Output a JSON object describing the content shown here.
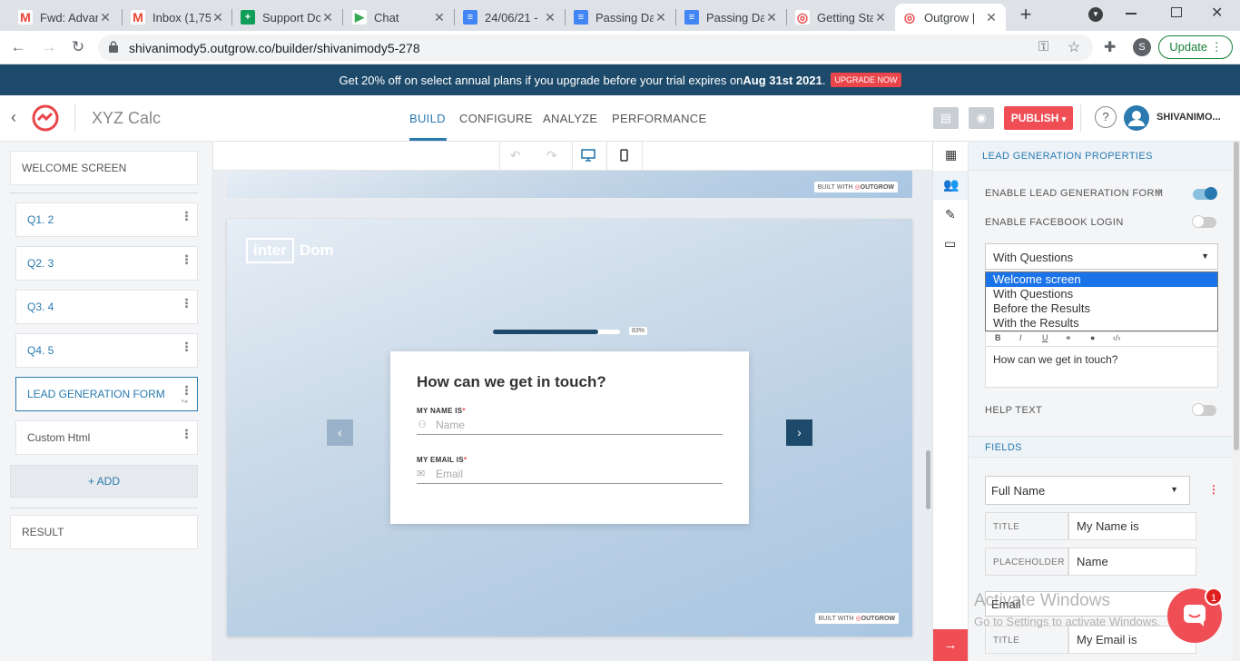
{
  "browser": {
    "tabs": [
      {
        "title": "Fwd: Advar",
        "icon": "gmail-icon",
        "color": "#ea4335",
        "glyph": "M"
      },
      {
        "title": "Inbox (1,75",
        "icon": "gmail-icon",
        "color": "#ea4335",
        "glyph": "M"
      },
      {
        "title": "Support Do",
        "icon": "sheets-icon",
        "color": "#0f9d58",
        "glyph": "+"
      },
      {
        "title": "Chat",
        "icon": "chat-icon",
        "color": "#34a853",
        "glyph": "▶"
      },
      {
        "title": "24/06/21 -",
        "icon": "docs-icon",
        "color": "#4285f4",
        "glyph": "≡"
      },
      {
        "title": "Passing Da",
        "icon": "docs-icon",
        "color": "#4285f4",
        "glyph": "≡"
      },
      {
        "title": "Passing Da",
        "icon": "docs-icon",
        "color": "#4285f4",
        "glyph": "≡"
      },
      {
        "title": "Getting Sta",
        "icon": "outgrow-icon",
        "color": "#e9454a",
        "glyph": "◎"
      },
      {
        "title": "Outgrow |",
        "icon": "outgrow-icon",
        "color": "#e9454a",
        "glyph": "◎"
      }
    ],
    "url": "shivanimody5.outgrow.co/builder/shivanimody5-278",
    "update_label": "Update",
    "profile_initial": "S"
  },
  "banner": {
    "text_before": "Get 20% off on select annual plans if you upgrade before your trial expires on ",
    "date": "Aug 31st 2021",
    "text_after": ".",
    "cta": "UPGRADE NOW"
  },
  "header": {
    "app_title": "XYZ Calc",
    "tabs": [
      "BUILD",
      "CONFIGURE",
      "ANALYZE",
      "PERFORMANCE"
    ],
    "publish_label": "PUBLISH",
    "help_label": "?",
    "user_name": "SHIVANIMO..."
  },
  "left": {
    "welcome": "WELCOME SCREEN",
    "questions": [
      "Q1. 2",
      "Q2. 3",
      "Q3. 4",
      "Q4. 5"
    ],
    "lead_form": "LEAD GENERATION FORM",
    "custom_html": "Custom Html",
    "add": "+ ADD",
    "result": "RESULT"
  },
  "canvas": {
    "built_with": "BUILT WITH",
    "outgrow": "OUTGROW",
    "logo_a": "inter",
    "logo_b": "Dom",
    "progress_pct": 83,
    "progress_label": "83%",
    "form_title": "How can we get in touch?",
    "name_label": "MY NAME IS",
    "name_placeholder": "Name",
    "email_label": "MY EMAIL IS",
    "email_placeholder": "Email",
    "required_mark": "*"
  },
  "right": {
    "section_title": "LEAD GENERATION PROPERTIES",
    "enable_lead_label": "ENABLE LEAD GENERATION FORM",
    "enable_lead_on": true,
    "enable_fb_label": "ENABLE FACEBOOK LOGIN",
    "enable_fb_on": false,
    "position_value": "With Questions",
    "position_options": [
      "Welcome screen",
      "With Questions",
      "Before the Results",
      "With the Results"
    ],
    "position_highlighted": 0,
    "title_text": "How can we get in touch?",
    "help_text_label": "HELP TEXT",
    "help_text_on": false,
    "fields_label": "FIELDS",
    "field1_type": "Full Name",
    "title_label": "TITLE",
    "title_value": "My Name is",
    "placeholder_label": "PLACEHOLDER",
    "placeholder_value": "Name",
    "field2_type": "Email",
    "title2_value": "My Email is",
    "activate_title": "Activate Windows",
    "activate_sub": "Go to Settings to activate Windows.",
    "chat_badge": "1"
  }
}
